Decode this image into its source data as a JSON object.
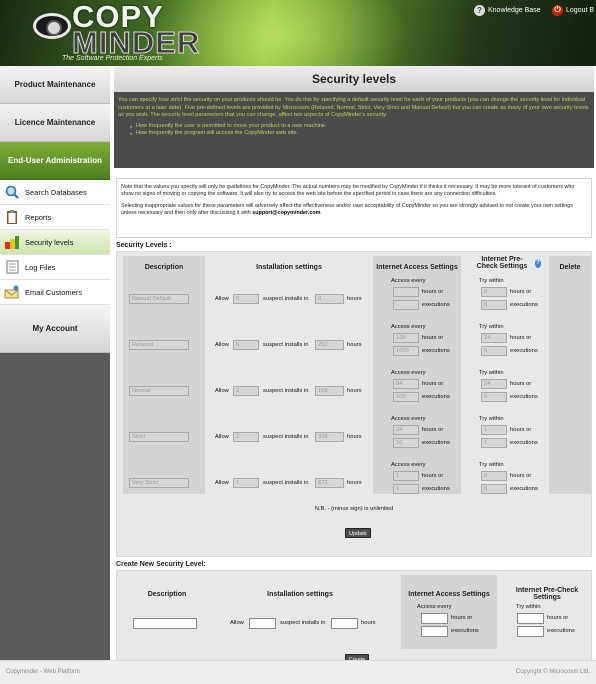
{
  "header": {
    "logo_line1": "COPY",
    "logo_line2": "MINDER",
    "tagline": "The Software Protection Experts",
    "knowledge_base": "Knowledge Base",
    "logout": "Logout B"
  },
  "sidebar": {
    "product_maintenance": "Product Maintenance",
    "licence_maintenance": "Licence Maintenance",
    "end_user_admin": "End-User Administration",
    "items": [
      {
        "label": "Search Databases",
        "icon": "magnifier-icon"
      },
      {
        "label": "Reports",
        "icon": "clipboard-icon"
      },
      {
        "label": "Security levels",
        "icon": "padlock-icon"
      },
      {
        "label": "Log Files",
        "icon": "log-file-icon"
      },
      {
        "label": "Email Customers",
        "icon": "email-customers-icon"
      }
    ],
    "my_account": "My Account"
  },
  "page": {
    "title": "Security levels",
    "intro": "You can specify how strict the security on your products should be. You do this by specifying a default security level for each of your products (you can change the security level for individual customers at a later date). Five pre-defined levels are provided by Microcosm (Relaxed, Normal, Strict, Very Strict and Manual Default) but you can create as many of your own security levels as you wish. The security level parameters that you can change, affect two aspects of CopyMinder's security:",
    "bullets": [
      "How frequently the user is permitted to move your product to a new machine.",
      "How frequently the program will access the CopyMinder web site."
    ],
    "note1": "Note that the values you specify will only be guidelines for CopyMinder. The actual numbers may be modified by CopyMinder if it thinks it necessary. It may be more tolerant of customers who show no signs of moving or copying the software. It will also try to access the web site before the specified period in case there are any connection difficulties.",
    "note2": "Selecting inappropriate values for these parameters will adversely affect the effectiveness and/or user acceptability of CopyMinder so you are strongly advised to not create your own settings unless necessary and then only after discussing it with",
    "note_email": "support@copyminder.com",
    "note_end": "."
  },
  "levels": {
    "section_title": "Security Levels :",
    "headers": {
      "description": "Description",
      "installation": "Installation settings",
      "internet": "Internet Access Settings",
      "precheck": "Internet Pre-Check Settings",
      "delete": "Delete"
    },
    "labels": {
      "allow": "Allow",
      "suspect": "suspect installs in",
      "hours": "hours",
      "access_every": "Access every",
      "hours_or": "hours or",
      "executions": "executions",
      "try_within": "Try within"
    },
    "rows": [
      {
        "name": "Manual Default",
        "allow": "0",
        "installs_hours": "0",
        "access_hours": "-",
        "access_exec": "-",
        "try_hours": "0",
        "try_exec": "0"
      },
      {
        "name": "Relaxed",
        "allow": "5",
        "installs_hours": "252",
        "access_hours": "168",
        "access_exec": "1000",
        "try_hours": "24",
        "try_exec": "5"
      },
      {
        "name": "Normal",
        "allow": "2",
        "installs_hours": "168",
        "access_hours": "84",
        "access_exec": "100",
        "try_hours": "24",
        "try_exec": "5"
      },
      {
        "name": "Strict",
        "allow": "2",
        "installs_hours": "336",
        "access_hours": "24",
        "access_exec": "10",
        "try_hours": "1",
        "try_exec": "1"
      },
      {
        "name": "Very Strict",
        "allow": "1",
        "installs_hours": "672",
        "access_hours": "1",
        "access_exec": "1",
        "try_hours": "0",
        "try_exec": "0"
      }
    ],
    "nb": "N.B. - (minus sign) is unlimited",
    "update": "Update"
  },
  "create": {
    "section_title": "Create New Security Level:",
    "headers": {
      "description": "Description",
      "installation": "Installation settings",
      "internet": "Internet Access Settings",
      "precheck": "Internet Pre-Check Settings"
    },
    "create_button": "Create"
  },
  "footer": {
    "left": "Copyminder - Web Platform",
    "right": "Copyright © Microcosm Ltd."
  }
}
